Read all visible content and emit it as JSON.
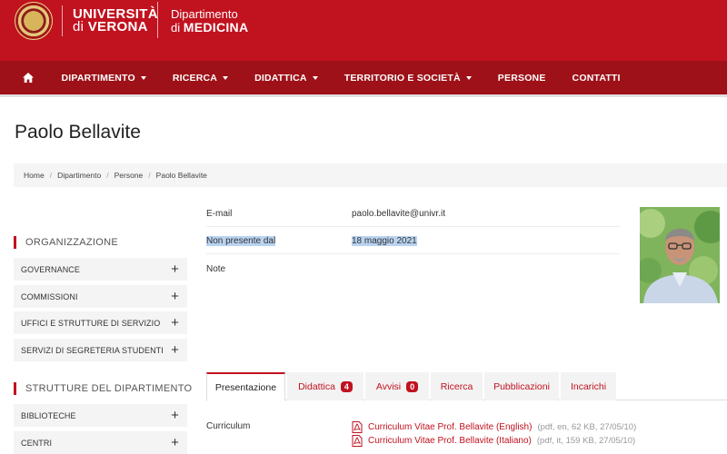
{
  "header": {
    "uni_line1": "UNIVERSITÀ",
    "uni_line2_prefix": "di",
    "uni_line2": "VERONA",
    "dep_line1": "Dipartimento",
    "dep_line2_prefix": "di",
    "dep_line2": "MEDICINA"
  },
  "nav": {
    "items": [
      {
        "label": "DIPARTIMENTO",
        "dropdown": true
      },
      {
        "label": "RICERCA",
        "dropdown": true
      },
      {
        "label": "DIDATTICA",
        "dropdown": true
      },
      {
        "label": "TERRITORIO E SOCIETÀ",
        "dropdown": true
      },
      {
        "label": "PERSONE",
        "dropdown": false
      },
      {
        "label": "CONTATTI",
        "dropdown": false
      }
    ]
  },
  "page_title": "Paolo Bellavite",
  "breadcrumb": [
    "Home",
    "Dipartimento",
    "Persone",
    "Paolo Bellavite"
  ],
  "sidebar": {
    "org_heading": "ORGANIZZAZIONE",
    "org_items": [
      "GOVERNANCE",
      "COMMISSIONI",
      "UFFICI E STRUTTURE DI SERVIZIO",
      "SERVIZI DI SEGRETERIA STUDENTI"
    ],
    "strutture_heading": "STRUTTURE DEL DIPARTIMENTO",
    "strutture_items": [
      "BIBLIOTECHE",
      "CENTRI"
    ]
  },
  "info": [
    {
      "label": "E-mail",
      "value": "paolo.bellavite@univr.it"
    },
    {
      "label": "Non presente dal",
      "value": "18 maggio 2021"
    },
    {
      "label": "Note",
      "value": ""
    }
  ],
  "tabs": [
    {
      "label": "Presentazione",
      "active": true
    },
    {
      "label": "Didattica",
      "badge": "4"
    },
    {
      "label": "Avvisi",
      "badge": "0"
    },
    {
      "label": "Ricerca"
    },
    {
      "label": "Pubblicazioni"
    },
    {
      "label": "Incarichi"
    }
  ],
  "curriculum": {
    "label": "Curriculum",
    "files": [
      {
        "title": "Curriculum Vitae Prof. Bellavite (English)",
        "meta": "(pdf, en, 62 KB, 27/05/10)"
      },
      {
        "title": "Curriculum Vitae Prof. Bellavite (Italiano)",
        "meta": "(pdf, it, 159 KB, 27/05/10)"
      }
    ]
  },
  "colors": {
    "brand_red": "#c1121f",
    "nav_red": "#9e1118",
    "highlight": "#b9d3f0"
  },
  "icons": [
    "university-seal-logo",
    "home-icon",
    "plus-icon",
    "pdf-icon"
  ]
}
